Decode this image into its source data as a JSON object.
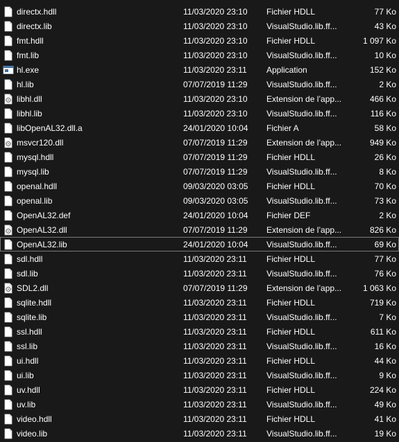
{
  "files": [
    {
      "name": "directx.hdll",
      "date": "11/03/2020 23:10",
      "type": "Fichier HDLL",
      "size": "77 Ko",
      "icon": "file-icon"
    },
    {
      "name": "directx.lib",
      "date": "11/03/2020 23:10",
      "type": "VisualStudio.lib.ff...",
      "size": "43 Ko",
      "icon": "file-icon"
    },
    {
      "name": "fmt.hdll",
      "date": "11/03/2020 23:10",
      "type": "Fichier HDLL",
      "size": "1 097 Ko",
      "icon": "file-icon"
    },
    {
      "name": "fmt.lib",
      "date": "11/03/2020 23:10",
      "type": "VisualStudio.lib.ff...",
      "size": "10 Ko",
      "icon": "file-icon"
    },
    {
      "name": "hl.exe",
      "date": "11/03/2020 23:11",
      "type": "Application",
      "size": "152 Ko",
      "icon": "exe-icon"
    },
    {
      "name": "hl.lib",
      "date": "07/07/2019 11:29",
      "type": "VisualStudio.lib.ff...",
      "size": "2 Ko",
      "icon": "file-icon"
    },
    {
      "name": "libhl.dll",
      "date": "11/03/2020 23:10",
      "type": "Extension de l’app...",
      "size": "466 Ko",
      "icon": "dll-icon"
    },
    {
      "name": "libhl.lib",
      "date": "11/03/2020 23:10",
      "type": "VisualStudio.lib.ff...",
      "size": "116 Ko",
      "icon": "file-icon"
    },
    {
      "name": "libOpenAL32.dll.a",
      "date": "24/01/2020 10:04",
      "type": "Fichier A",
      "size": "58 Ko",
      "icon": "file-icon"
    },
    {
      "name": "msvcr120.dll",
      "date": "07/07/2019 11:29",
      "type": "Extension de l’app...",
      "size": "949 Ko",
      "icon": "dll-icon"
    },
    {
      "name": "mysql.hdll",
      "date": "07/07/2019 11:29",
      "type": "Fichier HDLL",
      "size": "26 Ko",
      "icon": "file-icon"
    },
    {
      "name": "mysql.lib",
      "date": "07/07/2019 11:29",
      "type": "VisualStudio.lib.ff...",
      "size": "8 Ko",
      "icon": "file-icon"
    },
    {
      "name": "openal.hdll",
      "date": "09/03/2020 03:05",
      "type": "Fichier HDLL",
      "size": "70 Ko",
      "icon": "file-icon"
    },
    {
      "name": "openal.lib",
      "date": "09/03/2020 03:05",
      "type": "VisualStudio.lib.ff...",
      "size": "73 Ko",
      "icon": "file-icon"
    },
    {
      "name": "OpenAL32.def",
      "date": "24/01/2020 10:04",
      "type": "Fichier DEF",
      "size": "2 Ko",
      "icon": "file-icon"
    },
    {
      "name": "OpenAL32.dll",
      "date": "07/07/2019 11:29",
      "type": "Extension de l’app...",
      "size": "826 Ko",
      "icon": "dll-icon"
    },
    {
      "name": "OpenAL32.lib",
      "date": "24/01/2020 10:04",
      "type": "VisualStudio.lib.ff...",
      "size": "69 Ko",
      "icon": "file-icon",
      "selected": true
    },
    {
      "name": "sdl.hdll",
      "date": "11/03/2020 23:11",
      "type": "Fichier HDLL",
      "size": "77 Ko",
      "icon": "file-icon"
    },
    {
      "name": "sdl.lib",
      "date": "11/03/2020 23:11",
      "type": "VisualStudio.lib.ff...",
      "size": "76 Ko",
      "icon": "file-icon"
    },
    {
      "name": "SDL2.dll",
      "date": "07/07/2019 11:29",
      "type": "Extension de l’app...",
      "size": "1 063 Ko",
      "icon": "dll-icon"
    },
    {
      "name": "sqlite.hdll",
      "date": "11/03/2020 23:11",
      "type": "Fichier HDLL",
      "size": "719 Ko",
      "icon": "file-icon"
    },
    {
      "name": "sqlite.lib",
      "date": "11/03/2020 23:11",
      "type": "VisualStudio.lib.ff...",
      "size": "7 Ko",
      "icon": "file-icon"
    },
    {
      "name": "ssl.hdll",
      "date": "11/03/2020 23:11",
      "type": "Fichier HDLL",
      "size": "611 Ko",
      "icon": "file-icon"
    },
    {
      "name": "ssl.lib",
      "date": "11/03/2020 23:11",
      "type": "VisualStudio.lib.ff...",
      "size": "16 Ko",
      "icon": "file-icon"
    },
    {
      "name": "ui.hdll",
      "date": "11/03/2020 23:11",
      "type": "Fichier HDLL",
      "size": "44 Ko",
      "icon": "file-icon"
    },
    {
      "name": "ui.lib",
      "date": "11/03/2020 23:11",
      "type": "VisualStudio.lib.ff...",
      "size": "9 Ko",
      "icon": "file-icon"
    },
    {
      "name": "uv.hdll",
      "date": "11/03/2020 23:11",
      "type": "Fichier HDLL",
      "size": "224 Ko",
      "icon": "file-icon"
    },
    {
      "name": "uv.lib",
      "date": "11/03/2020 23:11",
      "type": "VisualStudio.lib.ff...",
      "size": "49 Ko",
      "icon": "file-icon"
    },
    {
      "name": "video.hdll",
      "date": "11/03/2020 23:11",
      "type": "Fichier HDLL",
      "size": "41 Ko",
      "icon": "file-icon"
    },
    {
      "name": "video.lib",
      "date": "11/03/2020 23:11",
      "type": "VisualStudio.lib.ff...",
      "size": "19 Ko",
      "icon": "file-icon"
    }
  ],
  "colors": {
    "background": "#191919",
    "text": "#ffffff",
    "selection_border": "#7a7a7a"
  }
}
